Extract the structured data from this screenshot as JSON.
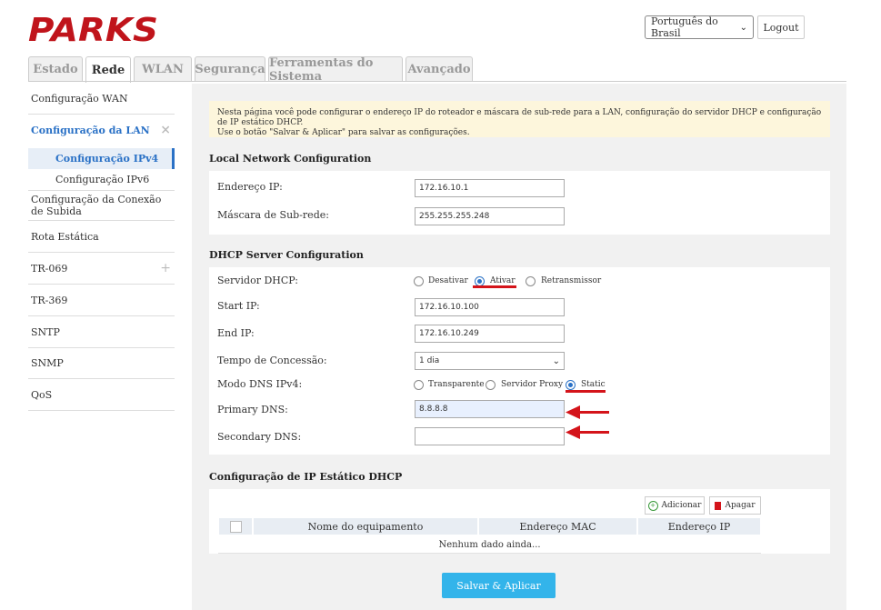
{
  "brand": {
    "logo_text": "PARKS",
    "logo_color": "#c0141b"
  },
  "header": {
    "language": "Português do Brasil",
    "logout_label": "Logout"
  },
  "tabs": [
    {
      "label": "Estado"
    },
    {
      "label": "Rede",
      "active": true
    },
    {
      "label": "WLAN"
    },
    {
      "label": "Segurança"
    },
    {
      "label": "Ferramentas do Sistema"
    },
    {
      "label": "Avançado"
    }
  ],
  "sidebar": {
    "items": [
      {
        "label": "Configuração WAN"
      },
      {
        "label": "Configuração da LAN",
        "mark": "×",
        "active": true
      },
      {
        "label": "Configuração da Conexão de Subida"
      },
      {
        "label": "Rota Estática"
      },
      {
        "label": "TR-069",
        "mark": "+"
      },
      {
        "label": "TR-369"
      },
      {
        "label": "SNTP"
      },
      {
        "label": "SNMP"
      },
      {
        "label": "QoS"
      }
    ],
    "subitems": [
      {
        "label": "Configuração IPv4",
        "active": true
      },
      {
        "label": "Configuração IPv6"
      }
    ]
  },
  "info": {
    "line1": "Nesta página você pode configurar o endereço IP do roteador e máscara de sub-rede para a LAN, configuração do servidor DHCP e configuração de IP estático DHCP.",
    "line2": "Use o botão \"Salvar & Aplicar\" para salvar as configurações."
  },
  "lan": {
    "title": "Local Network Configuration",
    "ip_label": "Endereço IP:",
    "ip_value": "172.16.10.1",
    "mask_label": "Máscara de Sub-rede:",
    "mask_value": "255.255.255.248"
  },
  "dhcp": {
    "title": "DHCP Server Configuration",
    "server_label": "Servidor DHCP:",
    "server_options": [
      "Desativar",
      "Ativar",
      "Retransmissor"
    ],
    "server_selected": "Ativar",
    "start_label": "Start IP:",
    "start_value": "172.16.10.100",
    "end_label": "End IP:",
    "end_value": "172.16.10.249",
    "lease_label": "Tempo de Concessão:",
    "lease_value": "1 dia",
    "dns_mode_label": "Modo DNS IPv4:",
    "dns_mode_options": [
      "Transparente",
      "Servidor Proxy",
      "Static"
    ],
    "dns_mode_selected": "Static",
    "primary_label": "Primary DNS:",
    "primary_value": "8.8.8.8",
    "secondary_label": "Secondary DNS:",
    "secondary_value": ""
  },
  "static": {
    "title": "Configuração de IP Estático DHCP",
    "add_label": "Adicionar",
    "delete_label": "Apagar",
    "columns": [
      "Nome do equipamento",
      "Endereço MAC",
      "Endereço IP"
    ],
    "empty_text": "Nenhum dado ainda..."
  },
  "save_label": "Salvar & Aplicar",
  "colors": {
    "accent": "#2a71c6",
    "annotation_red": "#d4141a",
    "save_button": "#33b4ea"
  }
}
